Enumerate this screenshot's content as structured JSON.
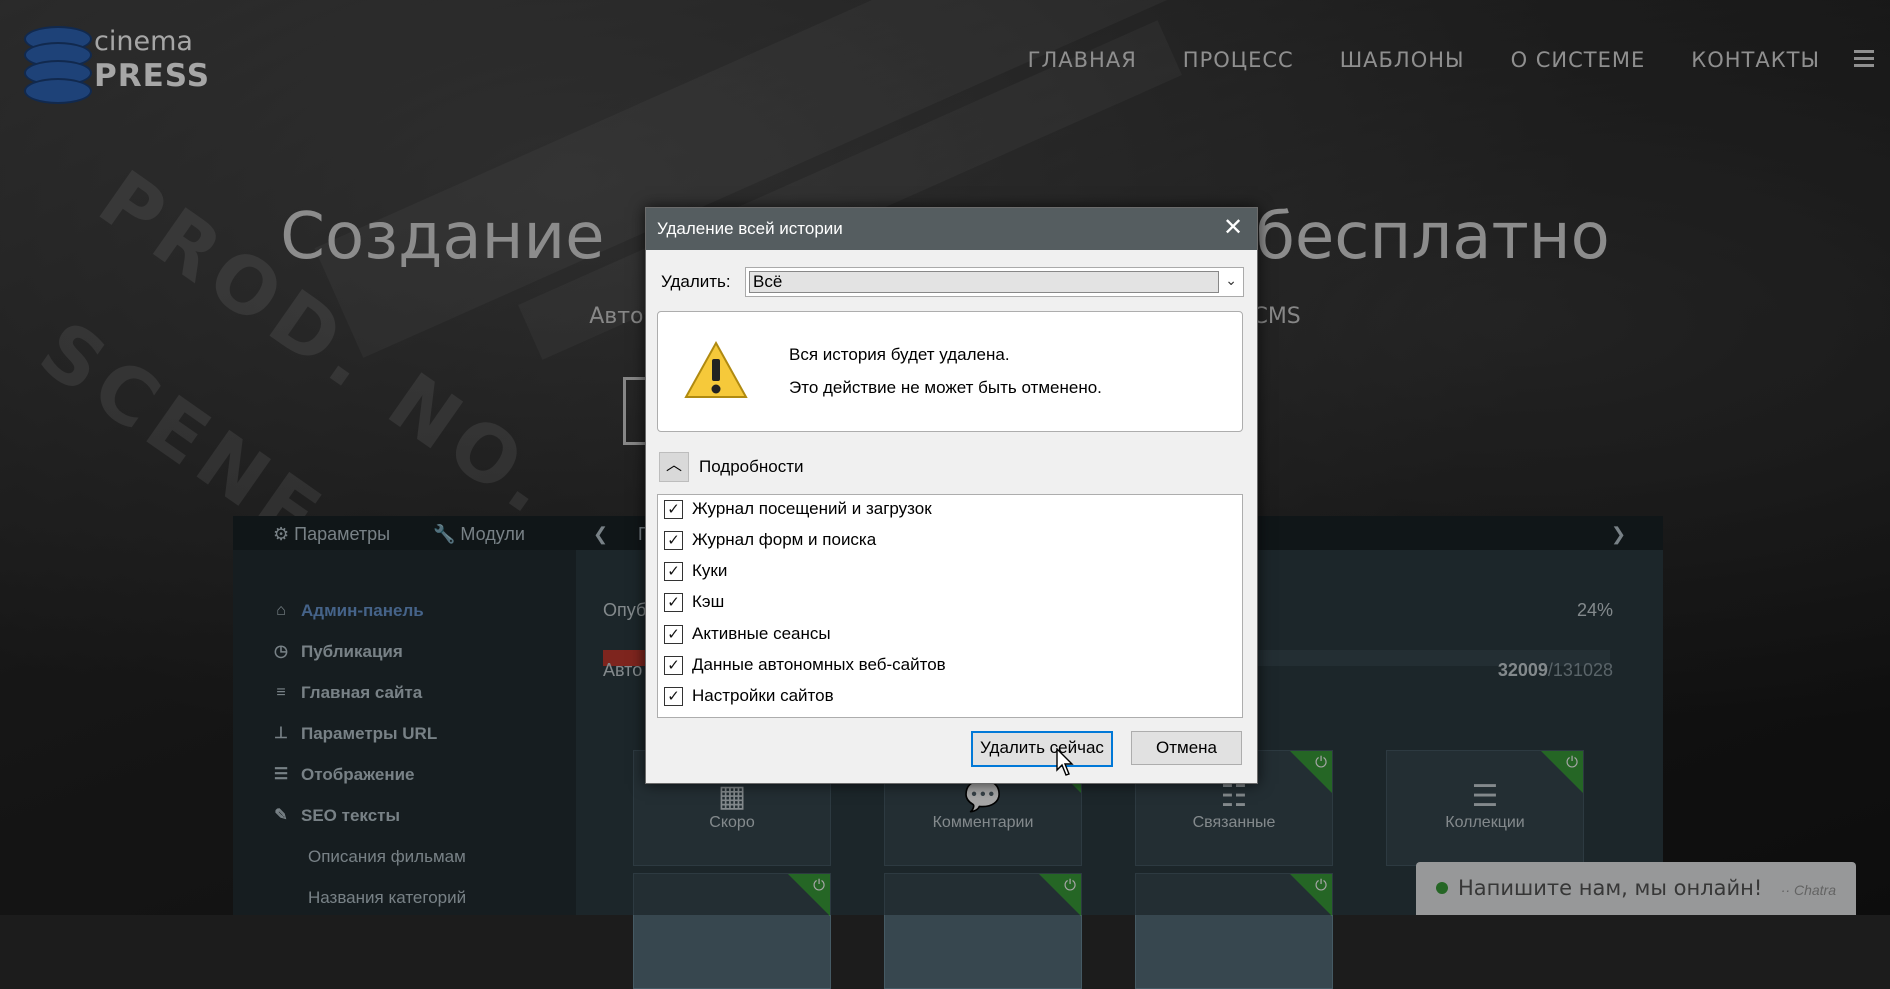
{
  "header": {
    "logo": {
      "line1": "cinema",
      "line2": "PRESS"
    },
    "nav": [
      "ГЛАВНАЯ",
      "ПРОЦЕСС",
      "ШАБЛОНЫ",
      "О СИСТЕМЕ",
      "КОНТАКТЫ"
    ]
  },
  "hero": {
    "title": "Создание                                бесплатно",
    "subtitle": "Автоматичес                                                              Press ACMS"
  },
  "background": {
    "slate_text": "PROD. NO.",
    "slate_text2": "SCENE"
  },
  "admin": {
    "tabs": [
      "Параметры",
      "Модули",
      "П"
    ],
    "sidebar": [
      "Админ-панель",
      "Публикация",
      "Главная сайта",
      "Параметры URL",
      "Отображение",
      "SEO тексты"
    ],
    "sidebar_sub": [
      "Описания фильмам",
      "Названия категорий"
    ],
    "published_label": "Опуб",
    "published_percent": "24%",
    "published_progress": 0.24,
    "auto_label": "Авто",
    "count_main": "32009",
    "count_total": "/131028",
    "tiles": [
      "Скоро",
      "Комментарии",
      "Связанные",
      "Коллекции"
    ]
  },
  "chat": {
    "message": "Напишите нам, мы онлайн!",
    "brand": "·· Chatra"
  },
  "dialog": {
    "title": "Удаление всей истории",
    "delete_label": "Удалить:",
    "delete_value": "Всё",
    "warning_line1": "Вся история будет удалена.",
    "warning_line2": "Это действие не может быть отменено.",
    "details_label": "Подробности",
    "items": [
      "Журнал посещений и загрузок",
      "Журнал форм и поиска",
      "Куки",
      "Кэш",
      "Активные сеансы",
      "Данные автономных веб-сайтов",
      "Настройки сайтов"
    ],
    "confirm_button": "Удалить сейчас",
    "cancel_button": "Отмена"
  },
  "colors": {
    "titlebar": "#555d60",
    "progress": "#c23a2e",
    "active_link": "#6b98d3",
    "tile_corner": "#3a9d3a"
  }
}
